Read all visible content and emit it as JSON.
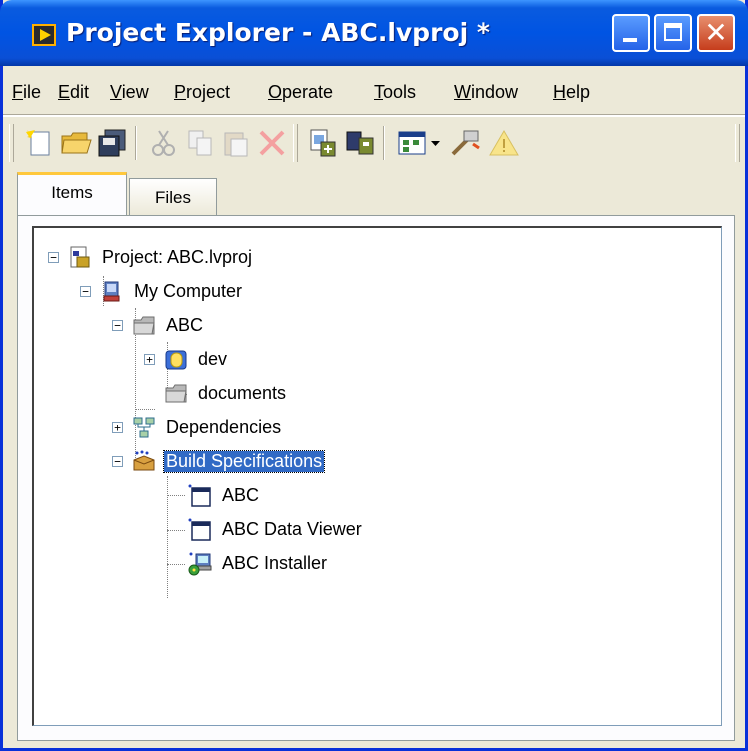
{
  "window": {
    "title": "Project Explorer - ABC.lvproj *",
    "close_glyph": "✕"
  },
  "menu": [
    {
      "label": "File"
    },
    {
      "label": "Edit"
    },
    {
      "label": "View"
    },
    {
      "label": "Project"
    },
    {
      "label": "Operate"
    },
    {
      "label": "Tools"
    },
    {
      "label": "Window"
    },
    {
      "label": "Help"
    }
  ],
  "toolbar": {
    "icons": [
      "new-icon",
      "open-icon",
      "save-all-icon",
      "cut-icon",
      "copy-icon",
      "paste-icon",
      "delete-icon",
      "add-file-icon",
      "build-icon",
      "view-icon",
      "dropdown-icon",
      "tool-icon",
      "warning-icon"
    ]
  },
  "tabs": [
    {
      "label": "Items",
      "active": true
    },
    {
      "label": "Files",
      "active": false
    }
  ],
  "tree": [
    {
      "label": "Project: ABC.lvproj",
      "icon": "project-icon",
      "expander": "−",
      "selected": false
    },
    {
      "label": "My Computer",
      "icon": "computer-icon",
      "expander": "−",
      "selected": false
    },
    {
      "label": "ABC",
      "icon": "folder-icon",
      "expander": "−",
      "selected": false
    },
    {
      "label": "dev",
      "icon": "library-icon",
      "expander": "+",
      "selected": false
    },
    {
      "label": "documents",
      "icon": "folder-icon",
      "expander": "",
      "selected": false
    },
    {
      "label": "Dependencies",
      "icon": "dependencies-icon",
      "expander": "+",
      "selected": false
    },
    {
      "label": "Build Specifications",
      "icon": "build-specs-icon",
      "expander": "−",
      "selected": true
    },
    {
      "label": "ABC",
      "icon": "application-icon",
      "expander": "",
      "selected": false
    },
    {
      "label": "ABC Data Viewer",
      "icon": "application-icon",
      "expander": "",
      "selected": false
    },
    {
      "label": "ABC Installer",
      "icon": "installer-icon",
      "expander": "",
      "selected": false
    }
  ],
  "colors": {
    "titlebar": "#0054e3",
    "selection": "#316ac5",
    "window_face": "#ece9d8"
  }
}
